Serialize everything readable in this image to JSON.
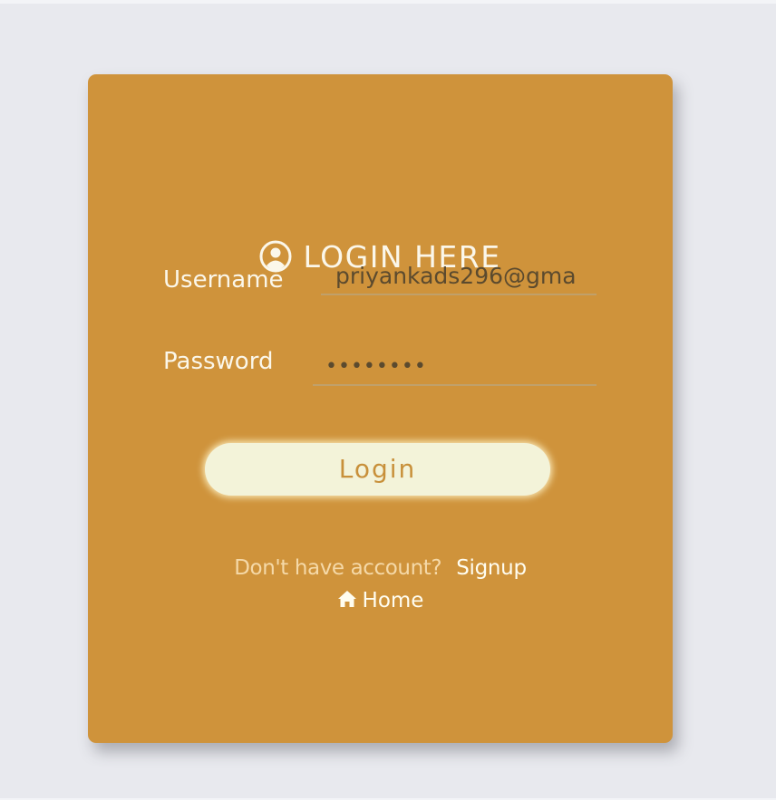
{
  "card": {
    "title": "LOGIN HERE",
    "title_icon": "user-circle-icon"
  },
  "form": {
    "username_label": "Username",
    "username_value": "priyankads296@gma",
    "password_label": "Password",
    "password_value": "••••••••",
    "login_label": "Login"
  },
  "footer": {
    "prompt": "Don't have account?",
    "signup_label": "Signup",
    "home_label": "Home",
    "home_icon": "home-icon"
  },
  "colors": {
    "page_bg": "#e8e9ee",
    "card_bg": "#cf933b",
    "button_bg": "#f3f3d9",
    "text_light": "#fbf7ea"
  }
}
